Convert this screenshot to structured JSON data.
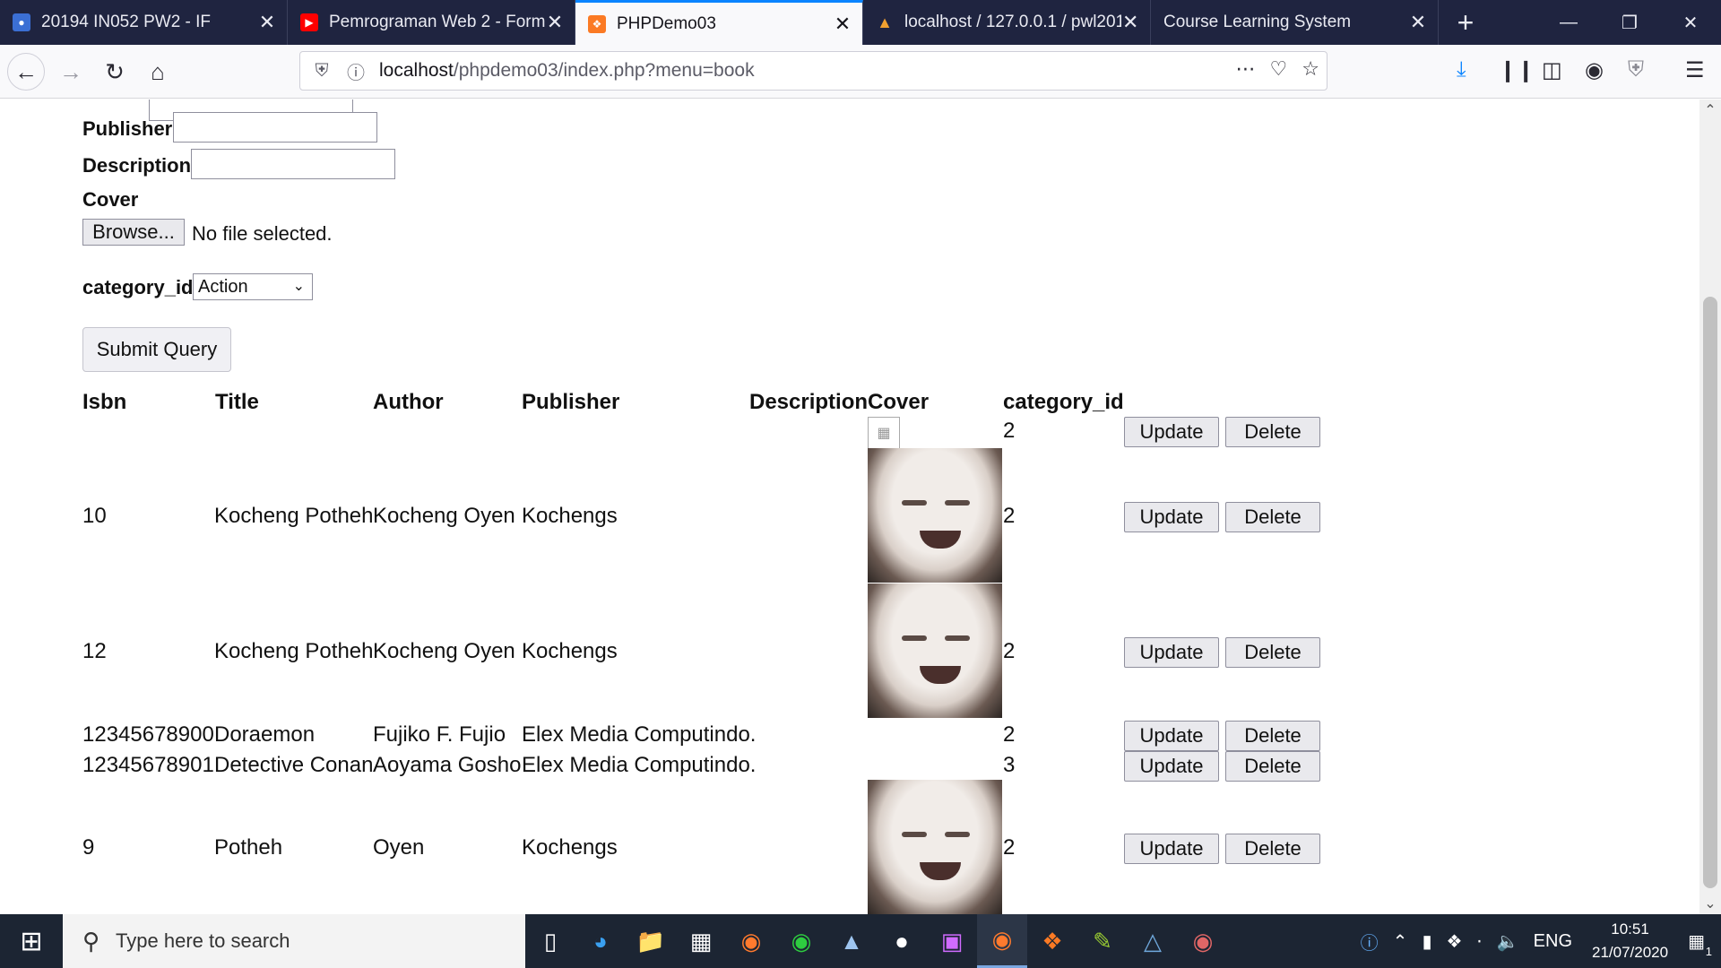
{
  "browser": {
    "tabs": [
      {
        "title": "20194 IN052 PW2 - IF",
        "icon": "person-icon",
        "color": "#3b6fd4",
        "active": false
      },
      {
        "title": "Pemrograman Web 2 - Form",
        "icon": "youtube-icon",
        "color": "#ff0000",
        "active": false
      },
      {
        "title": "PHPDemo03",
        "icon": "xampp-icon",
        "color": "#fb7a24",
        "active": true
      },
      {
        "title": "localhost / 127.0.0.1 / pwl201",
        "icon": "phpmyadmin-icon",
        "color": "#f0a030",
        "active": false
      },
      {
        "title": "Course Learning System",
        "icon": "",
        "color": "",
        "active": false
      }
    ],
    "new_tab": "+",
    "url_host": "localhost",
    "url_path": "/phpdemo03/index.php?menu=book"
  },
  "form": {
    "publisher_label": "Publisher",
    "description_label": "Description",
    "cover_label": "Cover",
    "browse_label": "Browse...",
    "no_file_text": "No file selected.",
    "category_label": "category_id",
    "category_selected": "Action",
    "submit_label": "Submit Query"
  },
  "table": {
    "headers": {
      "isbn": "Isbn",
      "title": "Title",
      "author": "Author",
      "publisher": "Publisher",
      "description": "Description",
      "cover": "Cover",
      "category": "category_id"
    },
    "update_label": "Update",
    "delete_label": "Delete",
    "rows": [
      {
        "isbn": "",
        "title": "",
        "author": "",
        "publisher": "",
        "description": "",
        "category": "2"
      },
      {
        "isbn": "10",
        "title": "Kocheng Potheh",
        "author": "Kocheng Oyen",
        "publisher": "Kochengs",
        "description": "",
        "category": "2"
      },
      {
        "isbn": "12",
        "title": "Kocheng Potheh",
        "author": "Kocheng Oyen",
        "publisher": "Kochengs",
        "description": "",
        "category": "2"
      },
      {
        "isbn": "12345678900",
        "title": "Doraemon",
        "author": "Fujiko F. Fujio",
        "publisher": "Elex Media Computindo.",
        "description": "",
        "category": "2"
      },
      {
        "isbn": "12345678901",
        "title": "Detective Conan",
        "author": "Aoyama Gosho",
        "publisher": "Elex Media Computindo.",
        "description": "",
        "category": "3"
      },
      {
        "isbn": "9",
        "title": "Potheh",
        "author": "Oyen",
        "publisher": "Kochengs",
        "description": "",
        "category": "2"
      }
    ]
  },
  "taskbar": {
    "search_placeholder": "Type here to search",
    "language": "ENG",
    "time": "10:51",
    "date": "21/07/2020",
    "notification_count": "1"
  }
}
